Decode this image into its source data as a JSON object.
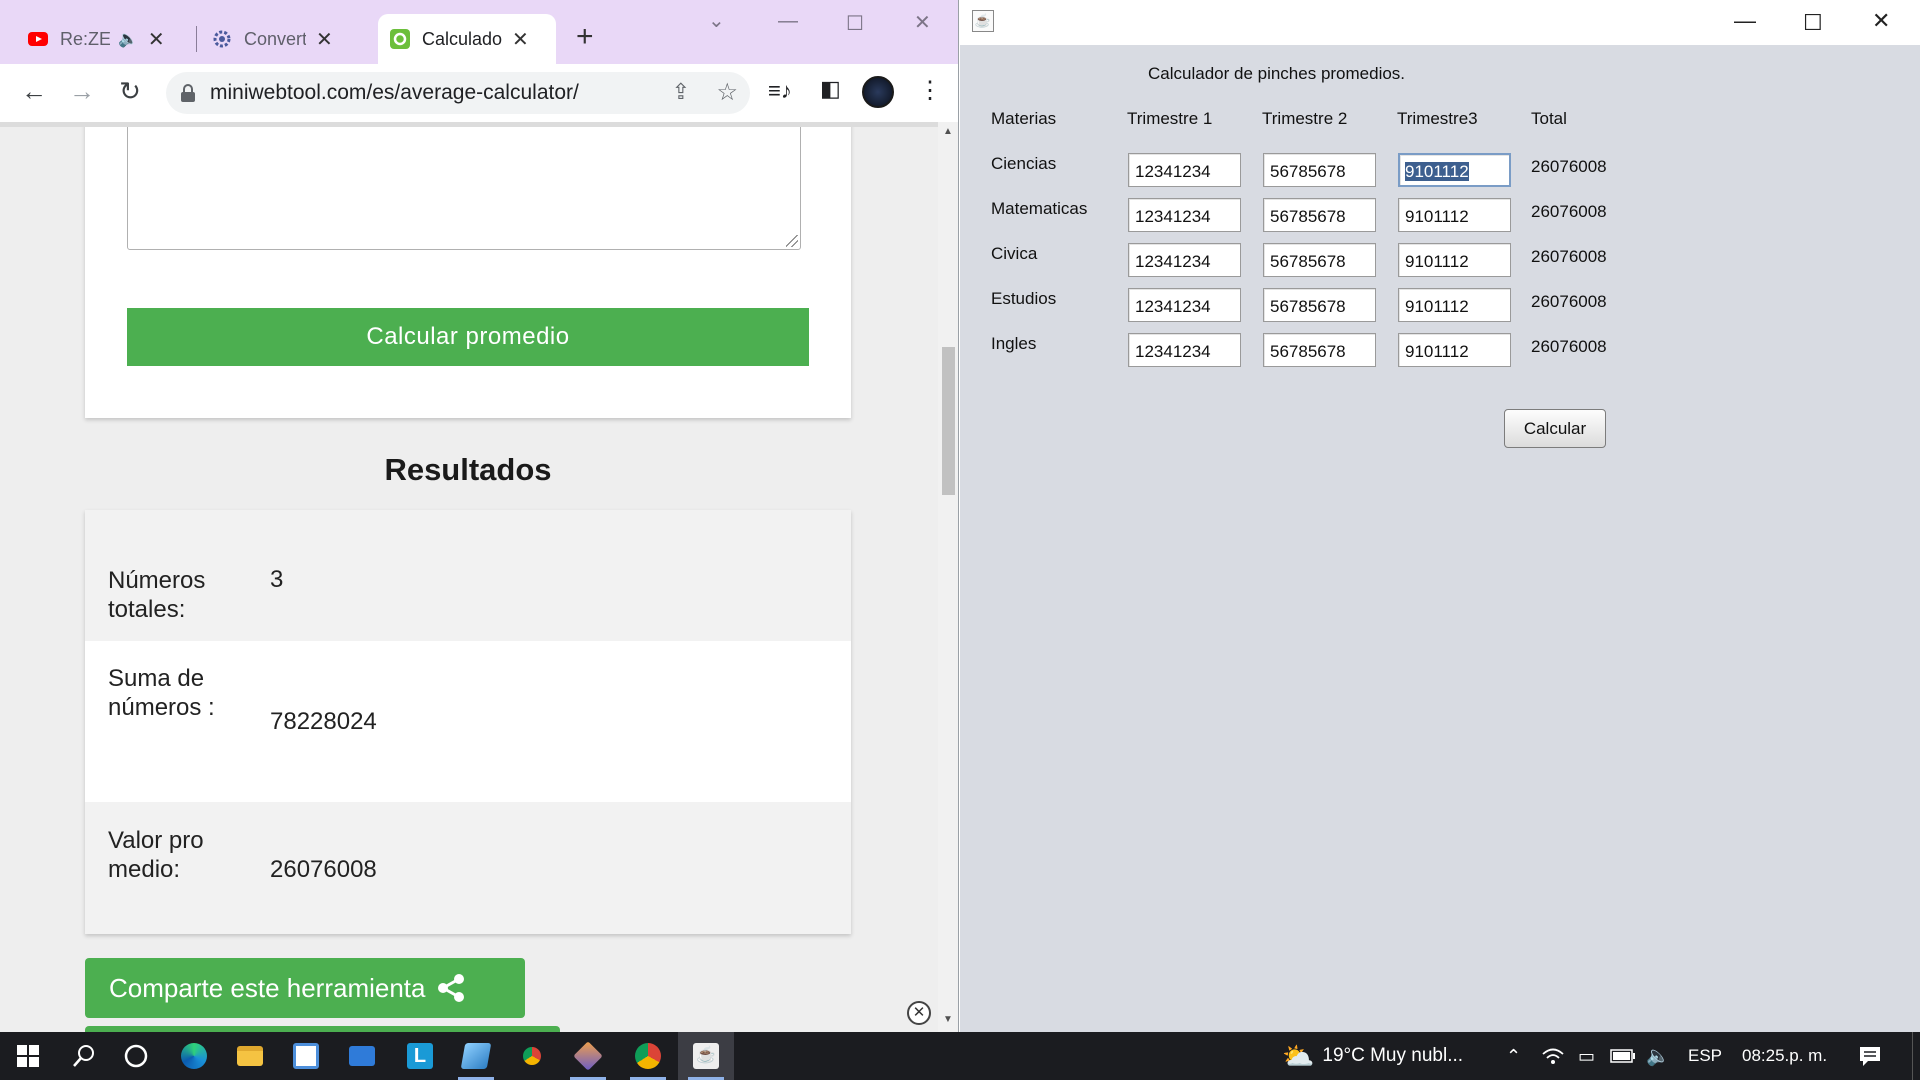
{
  "chrome": {
    "tabs": [
      {
        "title": "Re:ZERO",
        "active": false
      },
      {
        "title": "Convertir Unidades",
        "active": false
      },
      {
        "title": "Calculador",
        "active": true
      }
    ],
    "new_tab_symbol": "+",
    "url": "miniwebtool.com/es/average-calculator/",
    "page": {
      "calc_button": "Calcular promedio",
      "results_title": "Resultados",
      "results": [
        {
          "label": "Números totales:",
          "value": "3"
        },
        {
          "label": " Suma de números :",
          "value": "78228024"
        },
        {
          "label": " Valor promedio:",
          "value": "26076008"
        }
      ],
      "share_button": "Comparte este herramienta"
    }
  },
  "java": {
    "heading": "Calculador de pinches promedios.",
    "columns": [
      "Materias",
      "Trimestre 1",
      "Trimestre 2",
      "Trimestre3",
      "Total"
    ],
    "rows": [
      {
        "subject": "Ciencias",
        "t1": "12341234",
        "t2": "56785678",
        "t3": "9101112",
        "total": "26076008"
      },
      {
        "subject": "Matematicas",
        "t1": "12341234",
        "t2": "56785678",
        "t3": "9101112",
        "total": "26076008"
      },
      {
        "subject": "Civica",
        "t1": "12341234",
        "t2": "56785678",
        "t3": "9101112",
        "total": "26076008"
      },
      {
        "subject": "Estudios",
        "t1": "12341234",
        "t2": "56785678",
        "t3": "9101112",
        "total": "26076008"
      },
      {
        "subject": "Ingles",
        "t1": "12341234",
        "t2": "56785678",
        "t3": "9101112",
        "total": "26076008"
      }
    ],
    "calc_button": "Calcular"
  },
  "taskbar": {
    "weather": "19°C  Muy nubl...",
    "language": "ESP",
    "time": "08:25.p. m."
  }
}
